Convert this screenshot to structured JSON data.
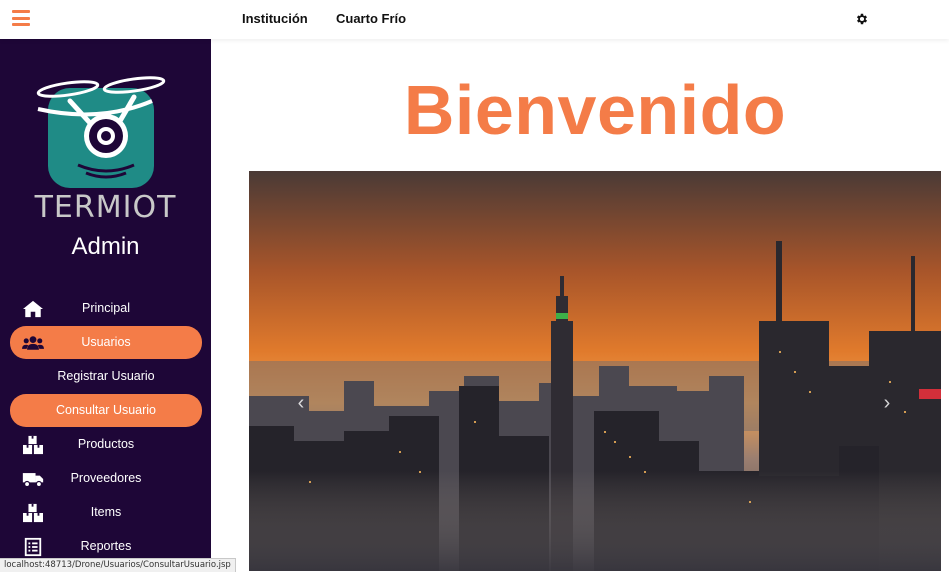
{
  "topbar": {
    "menu_icon": "hamburger-icon",
    "links": [
      "Institución",
      "Cuarto Frío"
    ],
    "settings_icon": "gear-icon"
  },
  "sidebar": {
    "brand": "TERMIOT",
    "role": "Admin",
    "items": [
      {
        "label": "Principal",
        "icon": "home-icon"
      },
      {
        "label": "Usuarios",
        "icon": "users-icon",
        "active": true
      },
      {
        "label": "Registrar Usuario"
      },
      {
        "label": "Consultar Usuario",
        "active": true
      },
      {
        "label": "Productos",
        "icon": "boxes-icon"
      },
      {
        "label": "Proveedores",
        "icon": "truck-icon"
      },
      {
        "label": "Items",
        "icon": "boxes-icon"
      },
      {
        "label": "Reportes",
        "icon": "report-icon"
      }
    ]
  },
  "main": {
    "welcome": "Bienvenido",
    "carousel": {
      "prev_icon": "chevron-left-icon",
      "next_icon": "chevron-right-icon",
      "prev_glyph": "‹",
      "next_glyph": "›"
    }
  },
  "status_bar": {
    "url": "localhost:48713/Drone/Usuarios/ConsultarUsuario.jsp"
  },
  "colors": {
    "accent": "#f47c48",
    "sidebar_bg": "#1e0637",
    "logo_teal": "#1f8b86"
  }
}
